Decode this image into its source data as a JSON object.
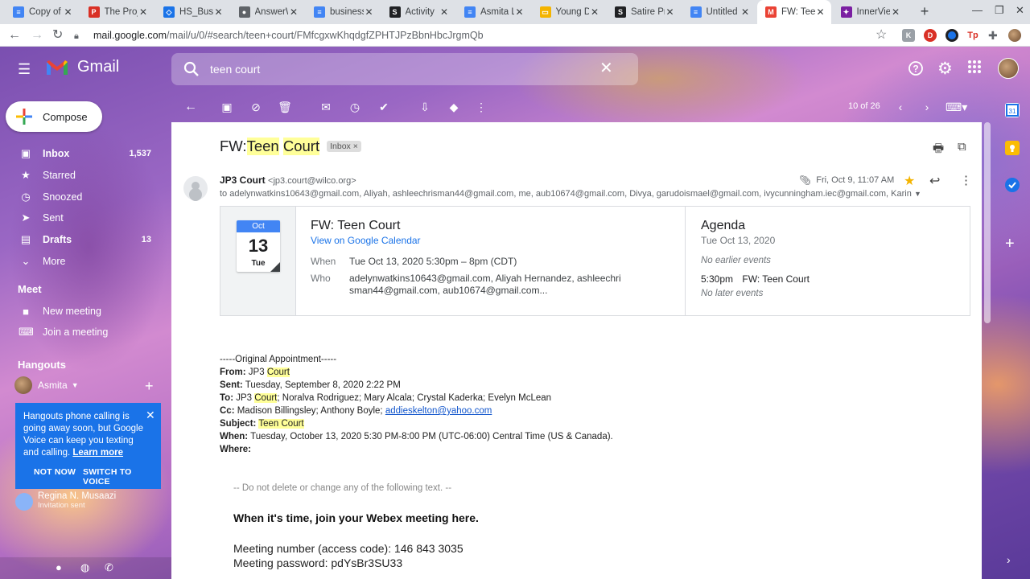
{
  "browser": {
    "tabs": [
      {
        "label": "Copy of G",
        "color": "#4285f4",
        "glyph": "≡"
      },
      {
        "label": "The Proje",
        "color": "#d93025",
        "glyph": "P"
      },
      {
        "label": "HS_Busin",
        "color": "#1a73e8",
        "glyph": "◇"
      },
      {
        "label": "AnswerW",
        "color": "#5f6368",
        "glyph": "●"
      },
      {
        "label": "business",
        "color": "#4285f4",
        "glyph": "≡"
      },
      {
        "label": "Activity",
        "color": "#202124",
        "glyph": "S"
      },
      {
        "label": "Asmita L",
        "color": "#4285f4",
        "glyph": "≡"
      },
      {
        "label": "Young D",
        "color": "#f4b400",
        "glyph": "▭"
      },
      {
        "label": "Satire Pr",
        "color": "#202124",
        "glyph": "S"
      },
      {
        "label": "Untitled",
        "color": "#4285f4",
        "glyph": "≡"
      },
      {
        "label": "FW: Teen",
        "color": "#ea4335",
        "glyph": "M"
      },
      {
        "label": "InnerView",
        "color": "#7b1fa2",
        "glyph": "✦"
      }
    ],
    "url_host": "mail.google.com",
    "url_path": "/mail/u/0/#search/teen+court/FMfcgxwKhqdgfZPHTJPzBbnHbcJrgmQb"
  },
  "gmail": {
    "brand": "Gmail",
    "search_value": "teen court",
    "compose_label": "Compose",
    "nav": [
      {
        "label": "Inbox",
        "count": "1,537",
        "icon": "▣",
        "bold": true
      },
      {
        "label": "Starred",
        "count": "",
        "icon": "★",
        "bold": false
      },
      {
        "label": "Snoozed",
        "count": "",
        "icon": "◷",
        "bold": false
      },
      {
        "label": "Sent",
        "count": "",
        "icon": "➤",
        "bold": false
      },
      {
        "label": "Drafts",
        "count": "13",
        "icon": "▤",
        "bold": true
      },
      {
        "label": "More",
        "count": "",
        "icon": "⌄",
        "bold": false
      }
    ],
    "meet_heading": "Meet",
    "meet_items": [
      {
        "label": "New meeting",
        "icon": "■"
      },
      {
        "label": "Join a meeting",
        "icon": "⌨"
      }
    ],
    "hangouts_heading": "Hangouts",
    "hangouts_user": "Asmita",
    "popup": {
      "text": "Hangouts phone calling is going away soon, but Google Voice can keep you texting and calling.",
      "learn_more": "Learn more",
      "not_now": "NOT NOW",
      "switch": "SWITCH TO VOICE"
    },
    "contact": {
      "name": "Regina N. Musaazi",
      "status": "Invitation sent"
    },
    "pager": "10 of 26"
  },
  "email": {
    "subject_prefix": "FW: ",
    "subject_hl1": "Teen",
    "subject_hl2": "Court",
    "label_badge": "Inbox ×",
    "sender_name": "JP3 Court",
    "sender_email": "<jp3.court@wilco.org>",
    "to_line": "to adelynwatkins10643@gmail.com, Aliyah, ashleechrisman44@gmail.com, me, aub10674@gmail.com, Divya, garudoismael@gmail.com, ivycunningham.iec@gmail.com, Karina, mmess",
    "date": "Fri, Oct 9, 11:07 AM",
    "invite": {
      "month": "Oct",
      "day": "13",
      "weekday": "Tue",
      "title": "FW: Teen Court",
      "link": "View on Google Calendar",
      "when_label": "When",
      "when_value": "Tue Oct 13, 2020 5:30pm – 8pm (CDT)",
      "who_label": "Who",
      "who_value1": "adelynwatkins10643@gmail.com, Aliyah Hernandez, ashleechri",
      "who_value2": "sman44@gmail.com, aub10674@gmail.com..."
    },
    "agenda": {
      "title": "Agenda",
      "date": "Tue Oct 13, 2020",
      "no_earlier": "No earlier events",
      "event_time": "5:30pm",
      "event_title": "FW: Teen Court",
      "no_later": "No later events"
    },
    "body": {
      "orig": "-----Original Appointment-----",
      "from_label": "From:",
      "from_value": " JP3 ",
      "from_hl": "Court",
      "sent_label": "Sent:",
      "sent_value": " Tuesday, September 8, 2020 2:22 PM",
      "to_label": "To:",
      "to_value1": " JP3 ",
      "to_hl": "Court",
      "to_value2": "; Noralva Rodriguez; Mary Alcala; Crystal Kaderka; Evelyn McLean",
      "cc_label": "Cc:",
      "cc_value": " Madison Billingsley; Anthony Boyle; ",
      "cc_link": "addieskelton@yahoo.com",
      "subject_label": "Subject:",
      "subject_hl": "Teen Court",
      "when_label": "When:",
      "when_value": " Tuesday, October 13, 2020 5:30 PM-8:00 PM (UTC-06:00) Central Time (US & Canada).",
      "where_label": "Where:",
      "note": "-- Do not delete or change any of the following text. --",
      "webex_head": "When it's time, join your Webex meeting here.",
      "meeting_number": "Meeting number (access code): 146 843 3035",
      "meeting_password": "Meeting password: pdYsBr3SU33"
    }
  }
}
